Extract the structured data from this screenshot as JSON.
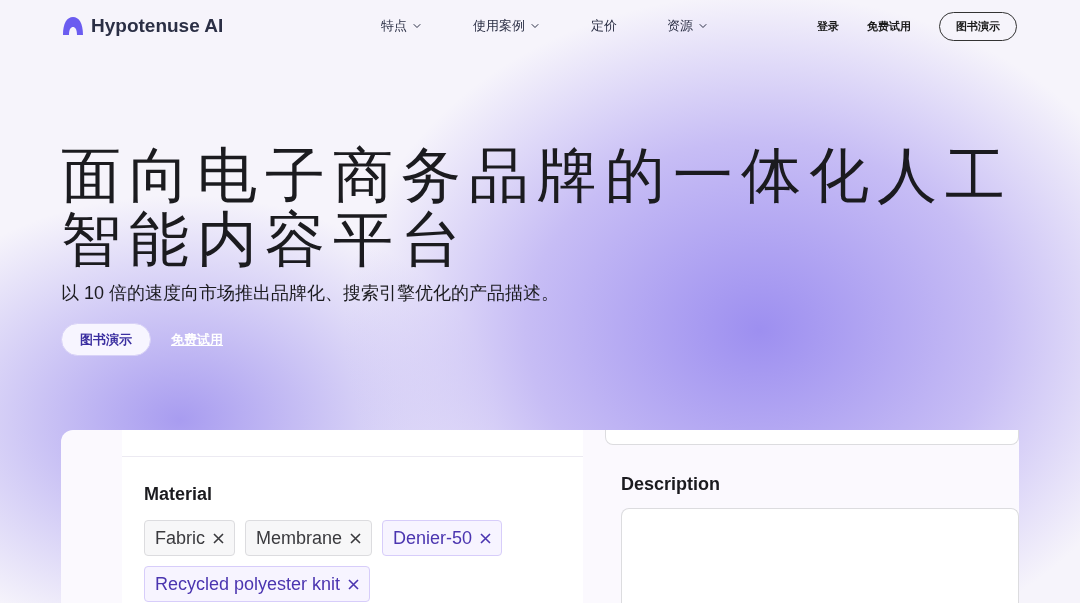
{
  "header": {
    "logo": "Hypotenuse AI",
    "nav": [
      {
        "label": "特点",
        "dropdown": true
      },
      {
        "label": "使用案例",
        "dropdown": true
      },
      {
        "label": "定价",
        "dropdown": false
      },
      {
        "label": "资源",
        "dropdown": true
      }
    ],
    "login": "登录",
    "free_trial": "免费试用",
    "demo_button": "图书演示"
  },
  "hero": {
    "title": "面向电子商务品牌的一体化人工智能内容平台",
    "subtitle": "以 10 倍的速度向市场推出品牌化、搜索引擎优化的产品描述。",
    "primary_button": "图书演示",
    "secondary_link": "免费试用"
  },
  "preview": {
    "material_label": "Material",
    "tags": [
      {
        "label": "Fabric",
        "selected": false
      },
      {
        "label": "Membrane",
        "selected": false
      },
      {
        "label": "Denier-50",
        "selected": true
      },
      {
        "label": "Recycled polyester knit",
        "selected": true
      }
    ],
    "description_label": "Description"
  }
}
